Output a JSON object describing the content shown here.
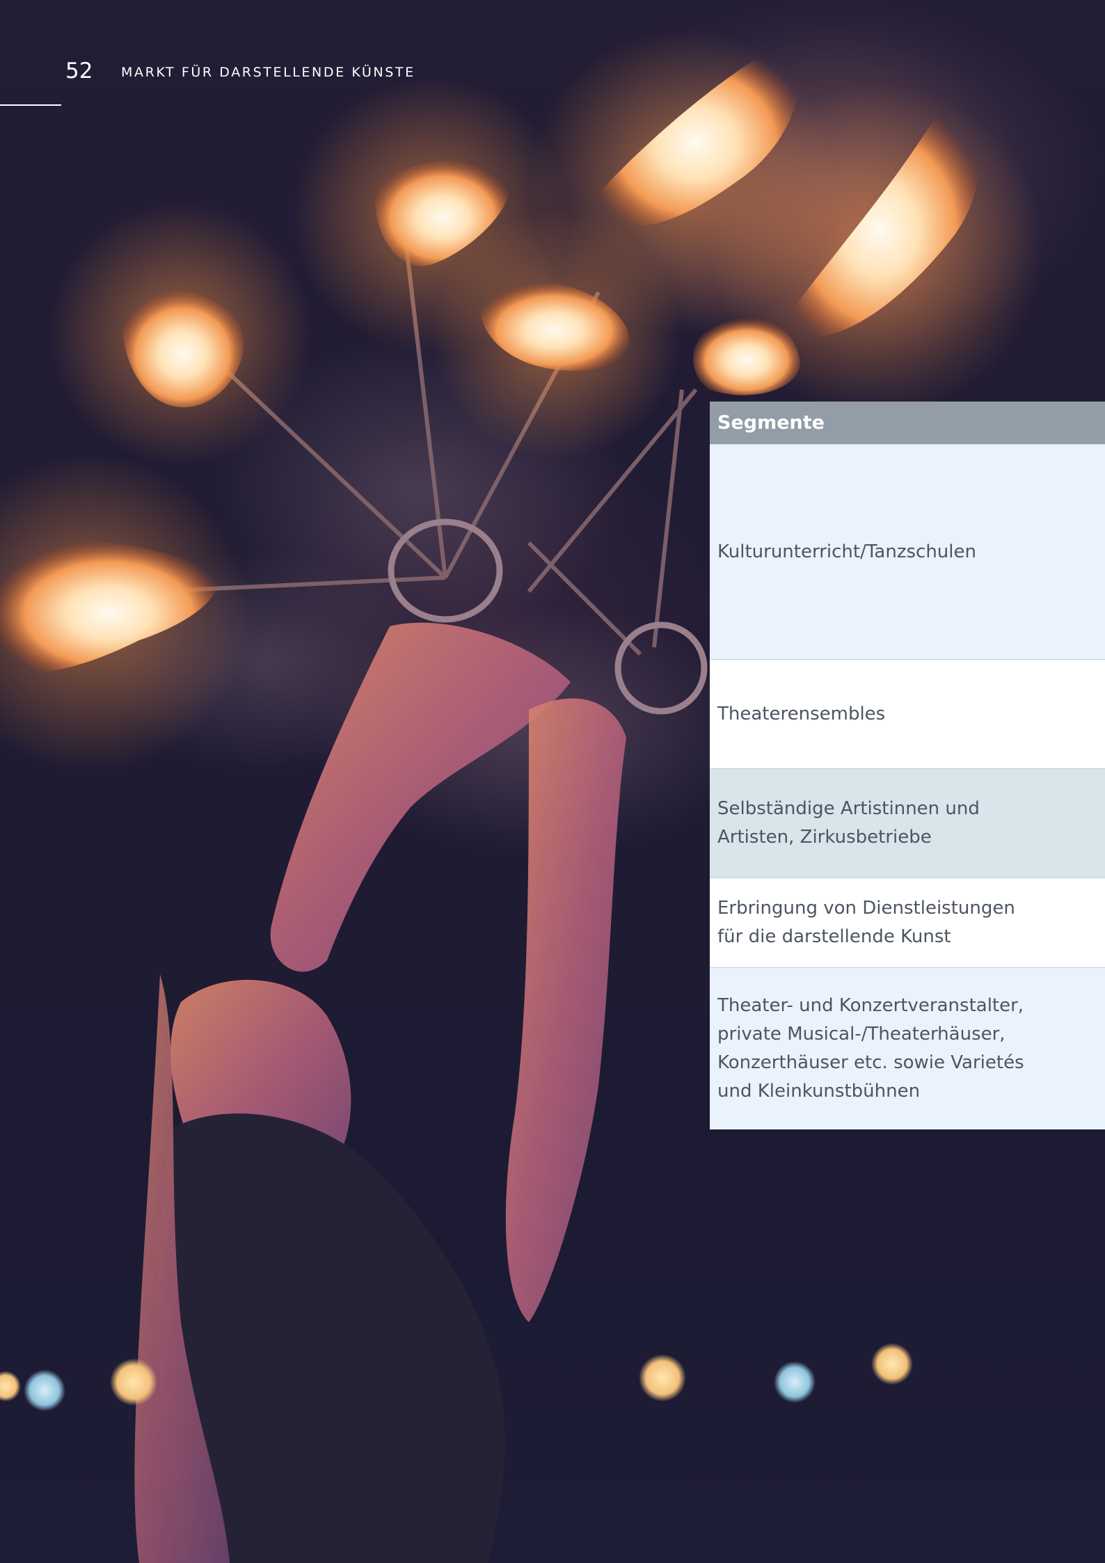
{
  "header": {
    "page_number": "52",
    "running_title": "MARKT FÜR DARSTELLENDE KÜNSTE"
  },
  "segments_table": {
    "heading": "Segmente",
    "rows": [
      {
        "label": "Kulturunterricht/Tanzschulen",
        "background": "#eaf2fb"
      },
      {
        "label": "Theaterensembles",
        "background": "#ffffff"
      },
      {
        "label": "Selbständige Artistinnen und\nArtisten, Zirkusbetriebe",
        "background": "#d9e5eb"
      },
      {
        "label": "Erbringung von Dienstleistungen\nfür die darstellende Kunst",
        "background": "#ffffff"
      },
      {
        "label": "Theater- und Konzertveranstalter,\nprivate Musical-/Theaterhäuser,\nKonzerthäuser etc. sowie Varietés\nund Kleinkunstbühnen",
        "background": "#eaf2fb"
      }
    ]
  },
  "colors": {
    "table_header": "#939da7",
    "table_text": "#4c5562",
    "page_background": "#1e1c34"
  }
}
